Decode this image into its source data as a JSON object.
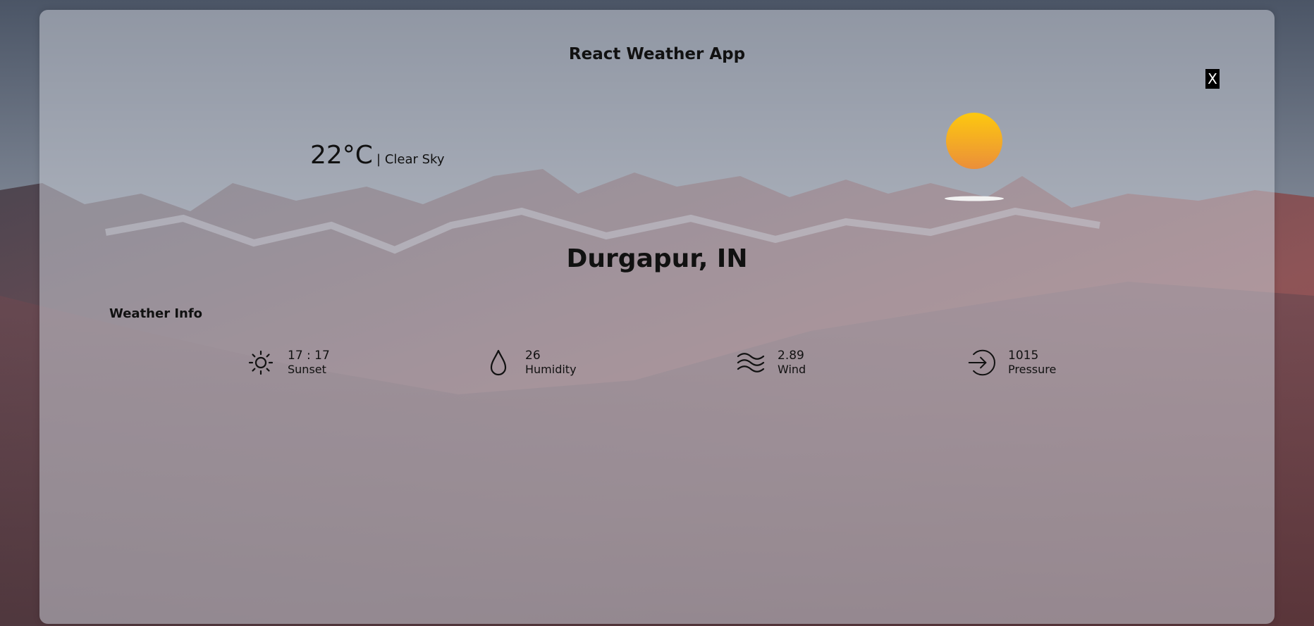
{
  "app": {
    "title": "React Weather App",
    "close_label": "X"
  },
  "weather": {
    "temperature": "22°C",
    "condition": "| Clear Sky",
    "city": "Durgapur, IN",
    "icon": "sun-icon"
  },
  "weather_info": {
    "heading": "Weather Info",
    "items": [
      {
        "value": "17 : 17",
        "label": "Sunset",
        "icon": "sun-outline-icon"
      },
      {
        "value": "26",
        "label": "Humidity",
        "icon": "droplet-icon"
      },
      {
        "value": "2.89",
        "label": "Wind",
        "icon": "wind-icon"
      },
      {
        "value": "1015",
        "label": "Pressure",
        "icon": "pressure-arrow-icon"
      }
    ]
  },
  "colors": {
    "sun_top": "#fdc80f",
    "sun_bottom": "#eb8f3a",
    "close_bg": "#000000"
  }
}
